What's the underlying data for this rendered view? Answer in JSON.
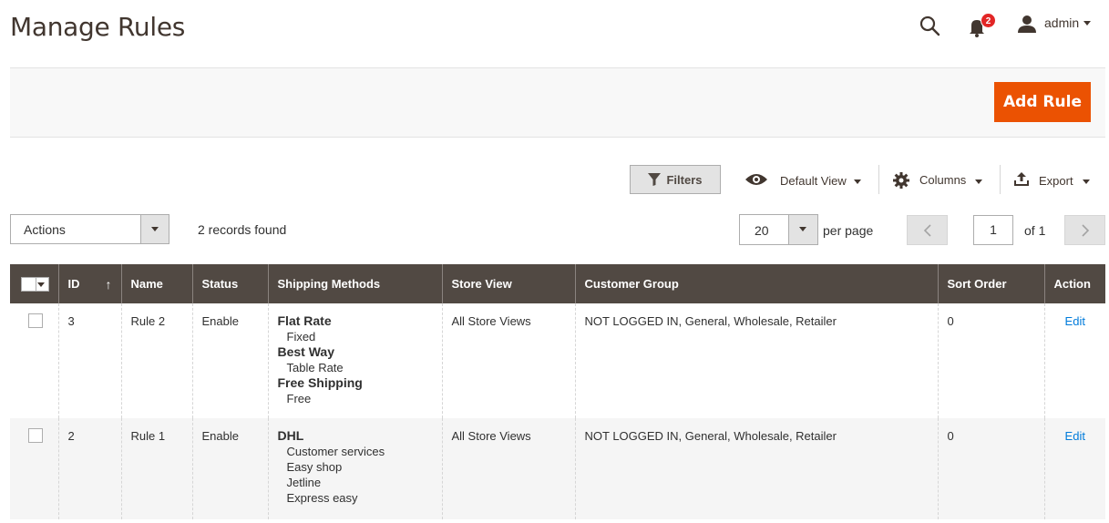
{
  "header": {
    "title": "Manage Rules",
    "notifications_count": "2",
    "user_name": "admin"
  },
  "action_bar": {
    "add_rule_label": "Add Rule"
  },
  "toolbar": {
    "filters_label": "Filters",
    "view_label": "Default View",
    "columns_label": "Columns",
    "export_label": "Export"
  },
  "controls": {
    "actions_label": "Actions",
    "records_found": "2 records found",
    "per_page_value": "20",
    "per_page_label": "per page",
    "page_number": "1",
    "page_total": "of 1"
  },
  "grid": {
    "columns": [
      "ID",
      "Name",
      "Status",
      "Shipping Methods",
      "Store View",
      "Customer Group",
      "Sort Order",
      "Action"
    ],
    "rows": [
      {
        "id": "3",
        "name": "Rule 2",
        "status": "Enable",
        "methods": [
          {
            "carrier": "Flat Rate",
            "options": [
              "Fixed"
            ]
          },
          {
            "carrier": "Best Way",
            "options": [
              "Table Rate"
            ]
          },
          {
            "carrier": "Free Shipping",
            "options": [
              "Free"
            ]
          }
        ],
        "store_view": "All Store Views",
        "customer_group": "NOT LOGGED IN, General, Wholesale, Retailer",
        "sort_order": "0",
        "action": "Edit"
      },
      {
        "id": "2",
        "name": "Rule 1",
        "status": "Enable",
        "methods": [
          {
            "carrier": "DHL",
            "options": [
              "Customer services",
              "Easy shop",
              "Jetline",
              "Express easy"
            ]
          }
        ],
        "store_view": "All Store Views",
        "customer_group": "NOT LOGGED IN, General, Wholesale, Retailer",
        "sort_order": "0",
        "action": "Edit"
      }
    ]
  },
  "colors": {
    "accent": "#eb5202",
    "grid_header": "#514943",
    "link": "#007bdb",
    "badge": "#e22626"
  }
}
